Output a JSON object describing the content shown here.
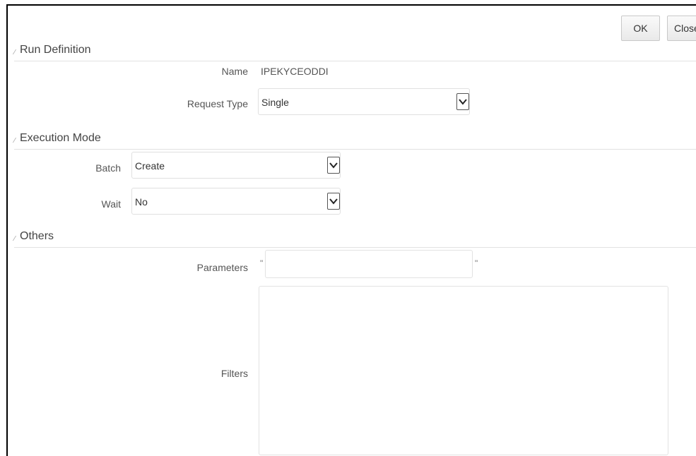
{
  "toolbar": {
    "ok_label": "OK",
    "close_label": "Close"
  },
  "sections": {
    "run_definition": {
      "title": "Run Definition",
      "name_label": "Name",
      "name_value": "IPEKYCEODDI",
      "request_type_label": "Request Type",
      "request_type_value": "Single"
    },
    "execution_mode": {
      "title": "Execution Mode",
      "batch_label": "Batch",
      "batch_value": "Create",
      "wait_label": "Wait",
      "wait_value": "No"
    },
    "others": {
      "title": "Others",
      "parameters_label": "Parameters",
      "parameters_value": "",
      "quote_open": "\"",
      "quote_close": "\"",
      "filters_label": "Filters",
      "filters_value": ""
    }
  },
  "icons": {
    "dropdown": "chevron-down-icon",
    "section_toggle": "twisty-expanded-icon"
  }
}
